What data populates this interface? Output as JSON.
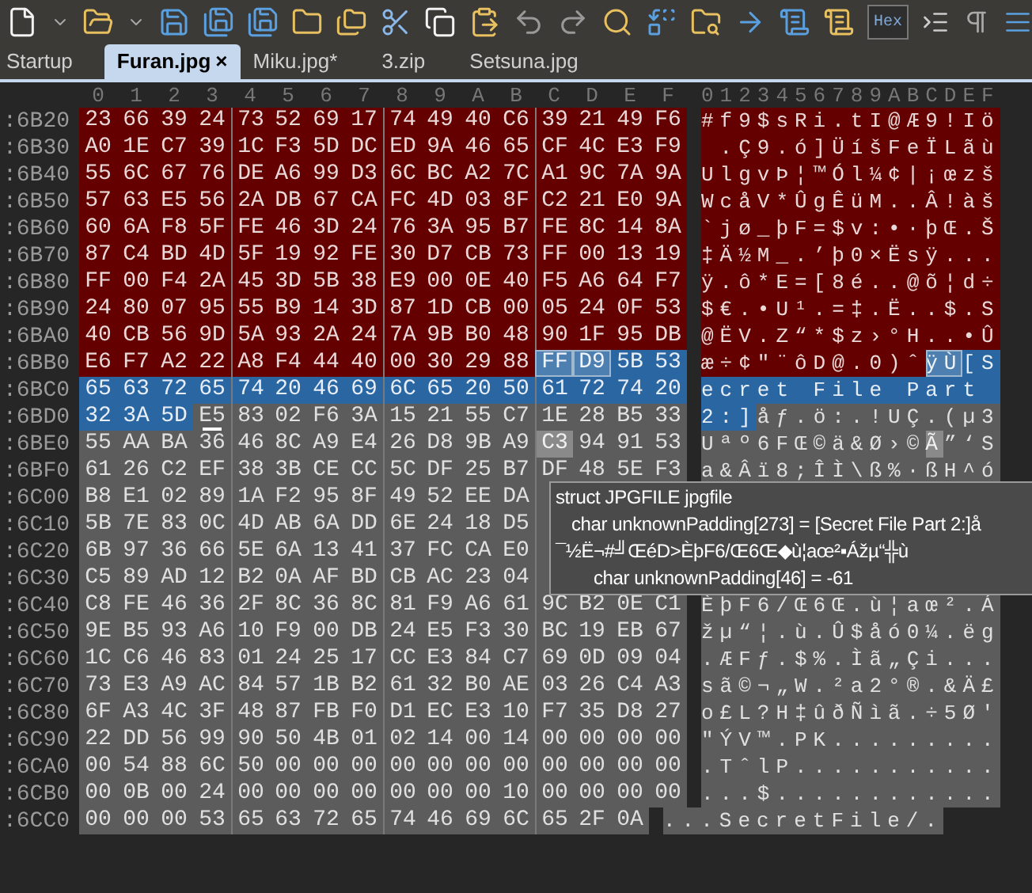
{
  "toolbar": {
    "hex_button": {
      "label": "Hex",
      "on": true
    }
  },
  "tabs": [
    {
      "label": "Startup",
      "selected": false
    },
    {
      "label": "Furan.jpg",
      "selected": true,
      "close": "×"
    },
    {
      "label": "Miku.jpg*",
      "selected": false
    },
    {
      "label": "3.zip",
      "selected": false
    },
    {
      "label": "Setsuna.jpg",
      "selected": false
    }
  ],
  "columns": [
    "0",
    "1",
    "2",
    "3",
    "4",
    "5",
    "6",
    "7",
    "8",
    "9",
    "A",
    "B",
    "C",
    "D",
    "E",
    "F"
  ],
  "ascii_header": "0123456789ABCDEF",
  "rows": [
    {
      "offset": ":6B20",
      "segments": [
        {
          "kind": "struct",
          "hex": [
            "23",
            "66",
            "39",
            "24",
            "73",
            "52",
            "69",
            "17",
            "74",
            "49",
            "40",
            "C6",
            "39",
            "21",
            "49",
            "F6"
          ],
          "text": "#f9$sRi.tI@Æ9!Iö"
        }
      ]
    },
    {
      "offset": ":6B30",
      "segments": [
        {
          "kind": "struct",
          "hex": [
            "A0",
            "1E",
            "C7",
            "39",
            "1C",
            "F3",
            "5D",
            "DC",
            "ED",
            "9A",
            "46",
            "65",
            "CF",
            "4C",
            "E3",
            "F9"
          ],
          "text": " .Ç9.ó]ÜíšFeÏLãù"
        }
      ]
    },
    {
      "offset": ":6B40",
      "segments": [
        {
          "kind": "struct",
          "hex": [
            "55",
            "6C",
            "67",
            "76",
            "DE",
            "A6",
            "99",
            "D3",
            "6C",
            "BC",
            "A2",
            "7C",
            "A1",
            "9C",
            "7A",
            "9A"
          ],
          "text": "UlgvÞ¦™Ól¼¢|¡œzš"
        }
      ]
    },
    {
      "offset": ":6B50",
      "segments": [
        {
          "kind": "struct",
          "hex": [
            "57",
            "63",
            "E5",
            "56",
            "2A",
            "DB",
            "67",
            "CA",
            "FC",
            "4D",
            "03",
            "8F",
            "C2",
            "21",
            "E0",
            "9A"
          ],
          "text": "WcåV*ÛgÊüM..Â!àš"
        }
      ]
    },
    {
      "offset": ":6B60",
      "segments": [
        {
          "kind": "struct",
          "hex": [
            "60",
            "6A",
            "F8",
            "5F",
            "FE",
            "46",
            "3D",
            "24",
            "76",
            "3A",
            "95",
            "B7",
            "FE",
            "8C",
            "14",
            "8A"
          ],
          "text": "`jø_þF=$v:•·þŒ.Š"
        }
      ]
    },
    {
      "offset": ":6B70",
      "segments": [
        {
          "kind": "struct",
          "hex": [
            "87",
            "C4",
            "BD",
            "4D",
            "5F",
            "19",
            "92",
            "FE",
            "30",
            "D7",
            "CB",
            "73",
            "FF",
            "00",
            "13",
            "19"
          ],
          "text": "‡Ä½M_.’þ0×Ësÿ..."
        }
      ]
    },
    {
      "offset": ":6B80",
      "segments": [
        {
          "kind": "struct",
          "hex": [
            "FF",
            "00",
            "F4",
            "2A",
            "45",
            "3D",
            "5B",
            "38",
            "E9",
            "00",
            "0E",
            "40",
            "F5",
            "A6",
            "64",
            "F7"
          ],
          "text": "ÿ.ô*E=[8é..@õ¦d÷"
        }
      ]
    },
    {
      "offset": ":6B90",
      "segments": [
        {
          "kind": "struct",
          "hex": [
            "24",
            "80",
            "07",
            "95",
            "55",
            "B9",
            "14",
            "3D",
            "87",
            "1D",
            "CB",
            "00",
            "05",
            "24",
            "0F",
            "53"
          ],
          "text": "$€.•U¹.=‡.Ë..$.S"
        }
      ]
    },
    {
      "offset": ":6BA0",
      "segments": [
        {
          "kind": "struct",
          "hex": [
            "40",
            "CB",
            "56",
            "9D",
            "5A",
            "93",
            "2A",
            "24",
            "7A",
            "9B",
            "B0",
            "48",
            "90",
            "1F",
            "95",
            "DB"
          ],
          "text": "@ËV.Z“*$z›°H..•Û"
        }
      ]
    },
    {
      "offset": ":6BB0",
      "segments": [
        {
          "kind": "struct",
          "hex": [
            "E6",
            "F7",
            "A2",
            "22",
            "A8",
            "F4",
            "44",
            "40",
            "00",
            "30",
            "29",
            "88"
          ],
          "text": "æ÷¢\"¨ôD@.0)ˆ"
        },
        {
          "kind": "found",
          "hex": [
            "FF",
            "D9"
          ],
          "text": "ÿÙ"
        },
        {
          "kind": "selection",
          "hex": [
            "5B",
            "53"
          ],
          "text": "[S"
        }
      ]
    },
    {
      "offset": ":6BC0",
      "segments": [
        {
          "kind": "selection",
          "hex": [
            "65",
            "63",
            "72",
            "65",
            "74",
            "20",
            "46",
            "69",
            "6C",
            "65",
            "20",
            "50",
            "61",
            "72",
            "74",
            "20"
          ],
          "text": "ecret File Part "
        }
      ]
    },
    {
      "offset": ":6BD0",
      "segments": [
        {
          "kind": "selection",
          "hex": [
            "32",
            "3A",
            "5D"
          ],
          "text": "2:]"
        },
        {
          "kind": "cursor",
          "hex": [
            "E5"
          ],
          "text": "å"
        },
        {
          "kind": "data",
          "hex": [
            "83",
            "02",
            "F6",
            "3A",
            "15",
            "21",
            "55",
            "C7",
            "1E",
            "28",
            "B5",
            "33"
          ],
          "text": "ƒ.ö:.!UÇ.(µ3"
        }
      ]
    },
    {
      "offset": ":6BE0",
      "segments": [
        {
          "kind": "data",
          "hex": [
            "55",
            "AA",
            "BA",
            "36",
            "46",
            "8C",
            "A9",
            "E4",
            "26",
            "D8",
            "9B",
            "A9"
          ],
          "text": "Uªº6FŒ©ä&Ø›©"
        },
        {
          "kind": "highlight",
          "hex": [
            "C3"
          ],
          "text": "Ã"
        },
        {
          "kind": "data",
          "hex": [
            "94",
            "91",
            "53"
          ],
          "text": "”‘S"
        }
      ]
    },
    {
      "offset": ":6BF0",
      "segments": [
        {
          "kind": "data",
          "hex": [
            "61",
            "26",
            "C2",
            "EF",
            "38",
            "3B",
            "CE",
            "CC",
            "5C",
            "DF",
            "25",
            "B7",
            "DF",
            "48",
            "5E",
            "F3"
          ],
          "text": "a&Âï8;ÎÌ\\ß%·ßH^ó"
        }
      ]
    },
    {
      "offset": ":6C00",
      "segments": [
        {
          "kind": "data",
          "hex": [
            "B8",
            "E1",
            "02",
            "89",
            "1A",
            "F2",
            "95",
            "8F",
            "49",
            "52",
            "EE",
            "DA"
          ]
        }
      ]
    },
    {
      "offset": ":6C10",
      "segments": [
        {
          "kind": "data",
          "hex": [
            "5B",
            "7E",
            "83",
            "0C",
            "4D",
            "AB",
            "6A",
            "DD",
            "6E",
            "24",
            "18",
            "D5"
          ]
        }
      ]
    },
    {
      "offset": ":6C20",
      "segments": [
        {
          "kind": "data",
          "hex": [
            "6B",
            "97",
            "36",
            "66",
            "5E",
            "6A",
            "13",
            "41",
            "37",
            "FC",
            "CA",
            "E0"
          ]
        }
      ]
    },
    {
      "offset": ":6C30",
      "segments": [
        {
          "kind": "data",
          "hex": [
            "C5",
            "89",
            "AD",
            "12",
            "B2",
            "0A",
            "AF",
            "BD",
            "CB",
            "AC",
            "23",
            "04"
          ]
        }
      ]
    },
    {
      "offset": ":6C40",
      "segments": [
        {
          "kind": "data",
          "hex": [
            "C8",
            "FE",
            "46",
            "36",
            "2F",
            "8C",
            "36",
            "8C",
            "81",
            "F9",
            "A6",
            "61",
            "9C",
            "B2",
            "0E",
            "C1"
          ],
          "text": "ÈþF6/Œ6Œ.ù¦aœ².Á"
        }
      ]
    },
    {
      "offset": ":6C50",
      "segments": [
        {
          "kind": "data",
          "hex": [
            "9E",
            "B5",
            "93",
            "A6",
            "10",
            "F9",
            "00",
            "DB",
            "24",
            "E5",
            "F3",
            "30",
            "BC",
            "19",
            "EB",
            "67"
          ],
          "text": "žµ“¦.ù.Û$åó0¼.ëg"
        }
      ]
    },
    {
      "offset": ":6C60",
      "segments": [
        {
          "kind": "data",
          "hex": [
            "1C",
            "C6",
            "46",
            "83",
            "01",
            "24",
            "25",
            "17",
            "CC",
            "E3",
            "84",
            "C7",
            "69",
            "0D",
            "09",
            "04"
          ],
          "text": ".ÆFƒ.$%.Ìã„Çi..."
        }
      ]
    },
    {
      "offset": ":6C70",
      "segments": [
        {
          "kind": "data",
          "hex": [
            "73",
            "E3",
            "A9",
            "AC",
            "84",
            "57",
            "1B",
            "B2",
            "61",
            "32",
            "B0",
            "AE",
            "03",
            "26",
            "C4",
            "A3"
          ],
          "text": "sã©¬„W.²a2°®.&Ä£"
        }
      ]
    },
    {
      "offset": ":6C80",
      "segments": [
        {
          "kind": "data",
          "hex": [
            "6F",
            "A3",
            "4C",
            "3F",
            "48",
            "87",
            "FB",
            "F0",
            "D1",
            "EC",
            "E3",
            "10",
            "F7",
            "35",
            "D8",
            "27"
          ],
          "text": "o£L?H‡ûðÑìã.÷5Ø'"
        }
      ]
    },
    {
      "offset": ":6C90",
      "segments": [
        {
          "kind": "data",
          "hex": [
            "22",
            "DD",
            "56",
            "99",
            "90",
            "50",
            "4B",
            "01",
            "02",
            "14",
            "00",
            "14",
            "00",
            "00",
            "00",
            "00"
          ],
          "text": "\"ÝV™.PK........."
        }
      ]
    },
    {
      "offset": ":6CA0",
      "segments": [
        {
          "kind": "data",
          "hex": [
            "00",
            "54",
            "88",
            "6C",
            "50",
            "00",
            "00",
            "00",
            "00",
            "00",
            "00",
            "00",
            "00",
            "00",
            "00",
            "00"
          ],
          "text": ".TˆlP..........."
        }
      ]
    },
    {
      "offset": ":6CB0",
      "segments": [
        {
          "kind": "data",
          "hex": [
            "00",
            "0B",
            "00",
            "24",
            "00",
            "00",
            "00",
            "00",
            "00",
            "00",
            "00",
            "10",
            "00",
            "00",
            "00",
            "00"
          ],
          "text": "...$............"
        }
      ]
    },
    {
      "offset": ":6CC0",
      "segments": [
        {
          "kind": "data",
          "hex": [
            "00",
            "00",
            "00",
            "53",
            "65",
            "63",
            "72",
            "65",
            "74",
            "46",
            "69",
            "6C",
            "65",
            "2F",
            "0A"
          ],
          "text": "...SecretFile/."
        }
      ]
    }
  ],
  "tooltip": {
    "title": "struct JPGFILE jpgfile",
    "lines": [
      "char unknownPadding[273] = [Secret File Part 2:]å",
      "¯½Ë¬#╝ŒéD>ÈþF6/Œ6Œ◆ù¦aœ²▪Ážµ“╬ù",
      "char unknownPadding[46] = -61"
    ]
  }
}
